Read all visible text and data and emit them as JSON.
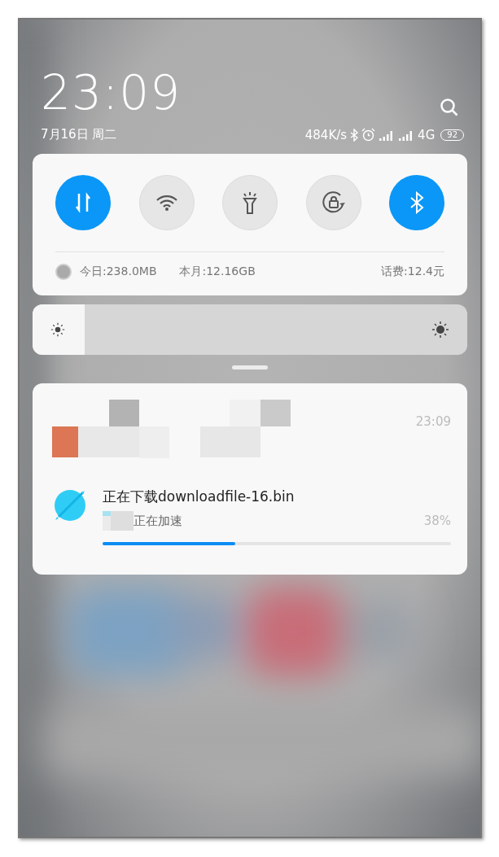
{
  "header": {
    "time": "23:09",
    "date": "7月16日 周二"
  },
  "status_bar": {
    "speed": "484K/s",
    "network": "4G",
    "battery": "92"
  },
  "toggles": [
    {
      "kind": "data",
      "on": true
    },
    {
      "kind": "wifi",
      "on": false
    },
    {
      "kind": "flashlight",
      "on": false
    },
    {
      "kind": "rotation-lock",
      "on": false
    },
    {
      "kind": "bluetooth",
      "on": true
    }
  ],
  "usage": {
    "today": "今日:238.0MB",
    "month": "本月:12.16GB",
    "fee": "话费:12.4元"
  },
  "brightness": {
    "level": 0.12
  },
  "notification": {
    "time": "23:09",
    "title": "正在下载downloadfile-16.bin",
    "subtitle": "正在加速",
    "percent": "38%",
    "level": 0.38
  }
}
